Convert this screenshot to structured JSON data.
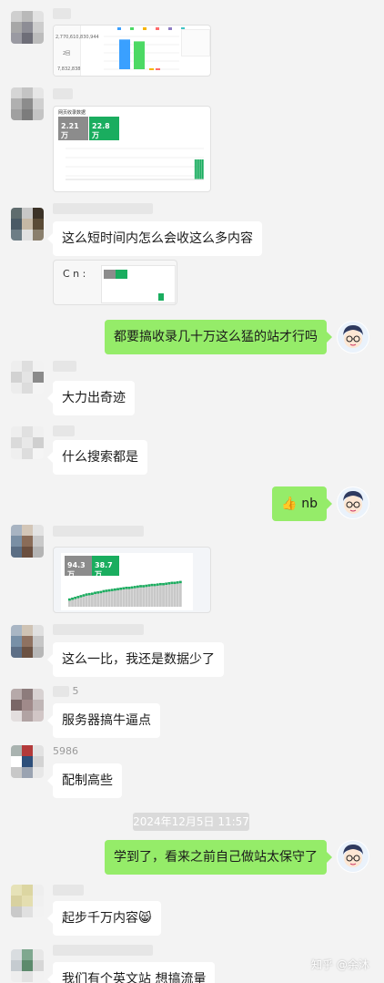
{
  "messages": [
    {
      "from": "left"
    },
    {
      "from": "left"
    },
    {
      "from": "left",
      "text": "这么短时间内怎么会收这么多内容"
    },
    {
      "from": "left",
      "caption": "C   n :"
    },
    {
      "from": "right",
      "text": "都要搞收录几十万这么猛的站才行吗"
    },
    {
      "from": "left",
      "text": "大力出奇迹"
    },
    {
      "from": "left",
      "text": "什么搜索都是"
    },
    {
      "from": "right",
      "emoji": "👍",
      "text": "nb"
    },
    {
      "from": "left",
      "stats": [
        "94.3万",
        "38.7万"
      ]
    },
    {
      "from": "left",
      "text": "这么一比，我还是数据少了"
    },
    {
      "from": "left",
      "sender": "5",
      "text": "服务器搞牛逼点"
    },
    {
      "from": "left",
      "sender": "5986",
      "text": "配制高些"
    },
    {
      "from": "right",
      "text": "学到了，看来之前自己做站太保守了"
    },
    {
      "from": "left",
      "text": "起步千万内容",
      "emoji": "😸"
    },
    {
      "from": "left",
      "text": "我们有个英文站 想搞流量"
    }
  ],
  "image1": {
    "stat_top": "2,770,610,830,944",
    "stat_mid": "2回",
    "stat_bottom": "7,832,838",
    "bars": [
      48,
      45
    ],
    "legend": [
      "全部",
      "百度",
      "360",
      "搜狗",
      "神马",
      "头条"
    ],
    "bar_colors": [
      "#3aa0ff",
      "#4cd964"
    ]
  },
  "image2": {
    "header": "网页收录数据",
    "stats": [
      "2.21万",
      "22.8万"
    ],
    "bars": [
      0,
      0,
      0,
      0,
      0,
      0,
      0,
      0,
      0,
      0,
      0,
      0,
      0,
      0,
      0,
      0,
      0,
      0,
      0,
      0,
      0,
      0,
      0,
      0,
      0,
      0,
      0,
      0,
      0,
      0,
      0,
      0,
      0,
      0,
      0,
      0,
      0,
      0,
      0,
      0,
      0,
      0,
      0,
      0,
      0,
      0,
      0,
      0,
      0,
      0,
      0,
      0,
      0,
      0,
      0,
      0,
      0,
      0,
      0,
      0,
      0,
      0,
      0,
      0,
      0,
      0,
      0,
      0,
      0,
      1,
      1,
      1,
      1,
      1
    ]
  },
  "image3": {
    "stats": [
      "94.3万",
      "38.7万"
    ],
    "series": [
      20,
      22,
      24,
      26,
      28,
      30,
      32,
      33,
      34,
      36,
      37,
      38,
      40,
      41,
      42,
      43,
      44,
      45,
      46,
      47,
      48,
      48,
      49,
      50,
      51,
      52,
      52,
      53,
      54,
      55,
      55,
      56,
      57,
      57,
      58,
      59,
      60,
      60,
      61,
      62
    ]
  },
  "timestamp": "2024年12月5日 11:57",
  "watermark": "知乎 @余沐",
  "colors": {
    "accent_green": "#95ec69",
    "chart_green": "#1aad5f",
    "chart_gray": "#8c8c8c"
  }
}
